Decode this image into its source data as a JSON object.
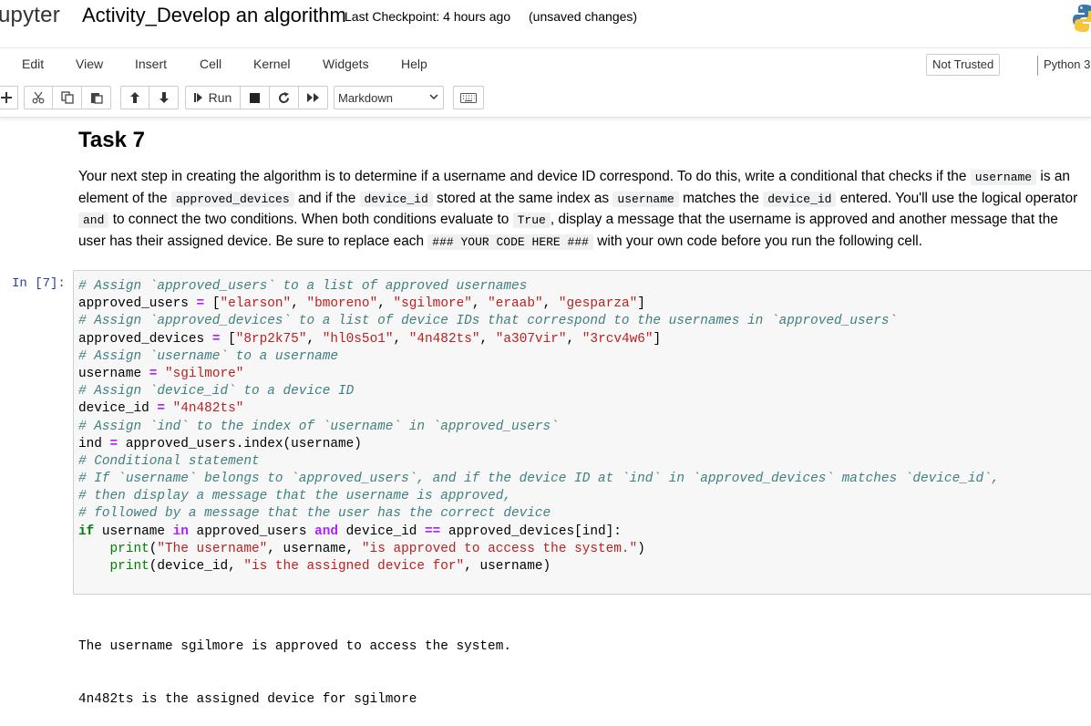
{
  "header": {
    "logo_text": "upyter",
    "notebook_title": "Activity_Develop an algorithm",
    "checkpoint": "Last Checkpoint: 4 hours ago",
    "unsaved": "(unsaved changes)"
  },
  "menu": {
    "items": [
      "Edit",
      "View",
      "Insert",
      "Cell",
      "Kernel",
      "Widgets",
      "Help"
    ],
    "trust": "Not Trusted",
    "kernel": "Python 3"
  },
  "toolbar": {
    "run_label": "Run",
    "cell_type": "Markdown",
    "icons": [
      "plus-icon",
      "scissors-icon",
      "copy-icon",
      "paste-icon",
      "arrow-up-icon",
      "arrow-down-icon",
      "run-icon",
      "stop-icon",
      "restart-icon",
      "fast-forward-icon",
      "keyboard-icon"
    ]
  },
  "markdown": {
    "heading": "Task 7",
    "p1": "Your next step in creating the algorithm is to determine if a username and device ID correspond. To do this, write a conditional that checks if the",
    "c1": "username",
    "p2": "is",
    "p3": "an element of the",
    "c2": "approved_devices",
    "p4": "and if the",
    "c3": "device_id",
    "p5": "stored at the same index as",
    "c4": "username",
    "p6": "matches the",
    "c5": "device_id",
    "p7": "entered. You'll use the",
    "p8": "logical operator",
    "c6": "and",
    "p9": "to connect the two conditions. When both conditions evaluate to",
    "c7": "True",
    "p10": ", display a message that the username is approved and another",
    "p11": "message that the user has their assigned device. Be sure to replace each",
    "c8": "### YOUR CODE HERE ###",
    "p12": "with your own code before you run the following cell."
  },
  "code_cell": {
    "prompt": "In [7]:",
    "lines": [
      "# Assign `approved_users` to a list of approved usernames",
      "approved_users = [\"elarson\", \"bmoreno\", \"sgilmore\", \"eraab\", \"gesparza\"]",
      "# Assign `approved_devices` to a list of device IDs that correspond to the usernames in `approved_users`",
      "approved_devices = [\"8rp2k75\", \"hl0s5o1\", \"4n482ts\", \"a307vir\", \"3rcv4w6\"]",
      "# Assign `username` to a username",
      "username = \"sgilmore\"",
      "# Assign `device_id` to a device ID",
      "device_id = \"4n482ts\"",
      "# Assign `ind` to the index of `username` in `approved_users`",
      "ind = approved_users.index(username)",
      "# Conditional statement",
      "# If `username` belongs to `approved_users`, and if the device ID at `ind` in `approved_devices` matches `device_id`,",
      "# then display a message that the username is approved,",
      "# followed by a message that the user has the correct device",
      "if username in approved_users and device_id == approved_devices[ind]:",
      "    print(\"The username\", username, \"is approved to access the system.\")",
      "    print(device_id, \"is the assigned device for\", username)"
    ]
  },
  "output": {
    "lines": [
      "The username sgilmore is approved to access the system.",
      "4n482ts is the assigned device for sgilmore"
    ]
  },
  "colors": {
    "comment": "#408080",
    "string": "#ba2121",
    "keyword": "#008000",
    "operator": "#aa22ff",
    "prompt": "#303f9f",
    "inline_code_bg": "#eef0f1"
  }
}
